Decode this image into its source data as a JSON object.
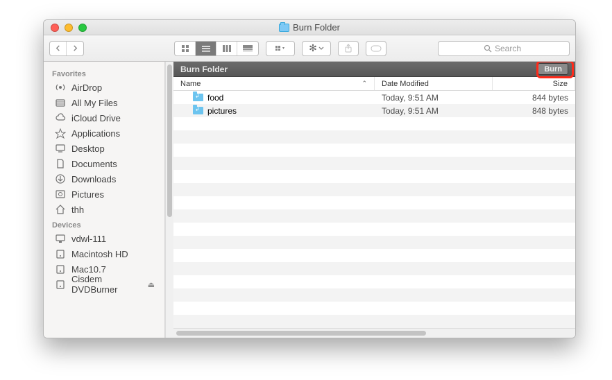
{
  "window": {
    "title": "Burn Folder"
  },
  "toolbar": {
    "search_placeholder": "Search"
  },
  "location": {
    "label": "Burn Folder",
    "burn_label": "Burn"
  },
  "columns": {
    "name": "Name",
    "date": "Date Modified",
    "size": "Size"
  },
  "rows": [
    {
      "name": "food",
      "date": "Today, 9:51 AM",
      "size": "844 bytes"
    },
    {
      "name": "pictures",
      "date": "Today, 9:51 AM",
      "size": "848 bytes"
    }
  ],
  "sidebar": {
    "sections": [
      {
        "heading": "Favorites",
        "items": [
          {
            "icon": "airdrop",
            "label": "AirDrop"
          },
          {
            "icon": "allfiles",
            "label": "All My Files"
          },
          {
            "icon": "cloud",
            "label": "iCloud Drive"
          },
          {
            "icon": "apps",
            "label": "Applications"
          },
          {
            "icon": "desktop",
            "label": "Desktop"
          },
          {
            "icon": "docs",
            "label": "Documents"
          },
          {
            "icon": "downloads",
            "label": "Downloads"
          },
          {
            "icon": "pictures",
            "label": "Pictures"
          },
          {
            "icon": "home",
            "label": "thh"
          }
        ]
      },
      {
        "heading": "Devices",
        "items": [
          {
            "icon": "machine",
            "label": "vdwl-111"
          },
          {
            "icon": "disk",
            "label": "Macintosh HD"
          },
          {
            "icon": "disk",
            "label": "Mac10.7"
          },
          {
            "icon": "disk",
            "label": "Cisdem DVDBurner",
            "eject": true
          }
        ]
      }
    ]
  }
}
